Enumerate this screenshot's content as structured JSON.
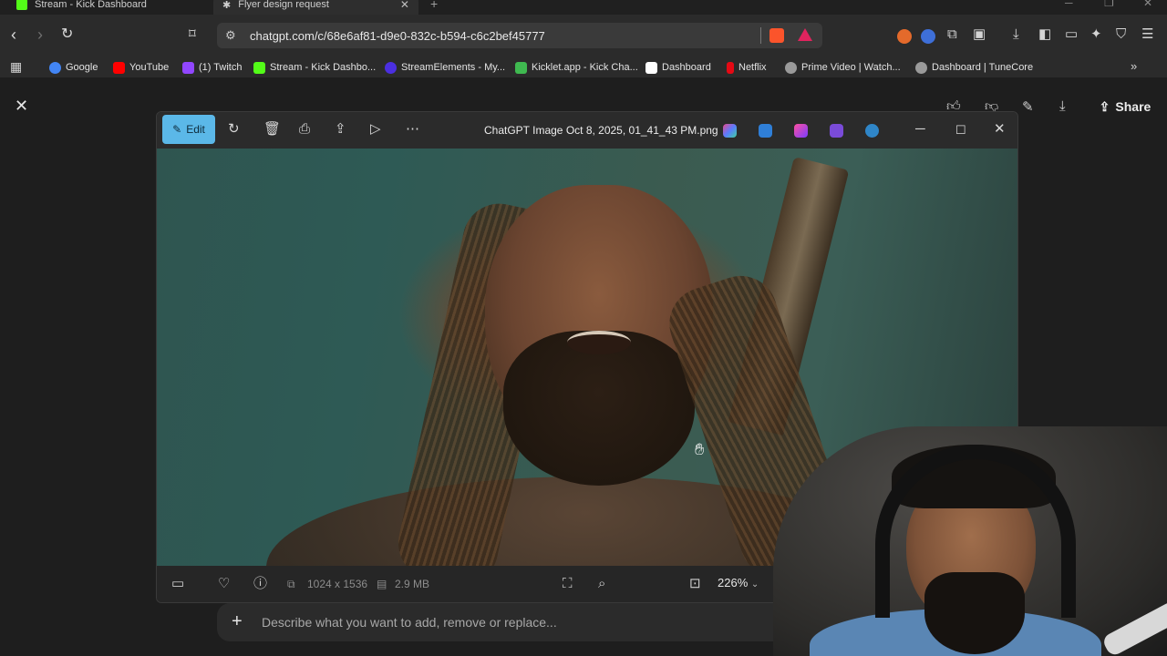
{
  "tabs": [
    {
      "label": "Stream - Kick Dashboard",
      "favicon_color": "#53fc18"
    },
    {
      "label": "Flyer design request",
      "active": true
    }
  ],
  "address_bar": {
    "url": "chatgpt.com/c/68e6af81-d9e0-832c-b594-c6c2bef45777"
  },
  "bookmarks": [
    {
      "label": "Google",
      "color": "#4285f4"
    },
    {
      "label": "YouTube",
      "color": "#ff0000"
    },
    {
      "label": "(1) Twitch",
      "color": "#9146ff"
    },
    {
      "label": "Stream - Kick Dashbo...",
      "color": "#53fc18"
    },
    {
      "label": "StreamElements - My...",
      "color": "#4b2fe0"
    },
    {
      "label": "Kicklet.app - Kick Cha...",
      "color": "#3fb950"
    },
    {
      "label": "Dashboard",
      "color": "#ffffff"
    },
    {
      "label": "Netflix",
      "color": "#e50914"
    },
    {
      "label": "Prime Video | Watch...",
      "color": "#9a9a9a"
    },
    {
      "label": "Dashboard | TuneCore",
      "color": "#9a9a9a"
    }
  ],
  "page": {
    "share_label": "Share"
  },
  "viewer": {
    "edit_label": "Edit",
    "file_name": "ChatGPT Image Oct 8, 2025, 01_41_43 PM.png",
    "dimensions": "1024 x 1536",
    "file_size": "2.9 MB",
    "zoom_level": "226%"
  },
  "prompt": {
    "placeholder": "Describe what you want to add, remove or replace..."
  },
  "colors": {
    "accent": "#5bb8e8",
    "background": "#1e1e1e"
  }
}
